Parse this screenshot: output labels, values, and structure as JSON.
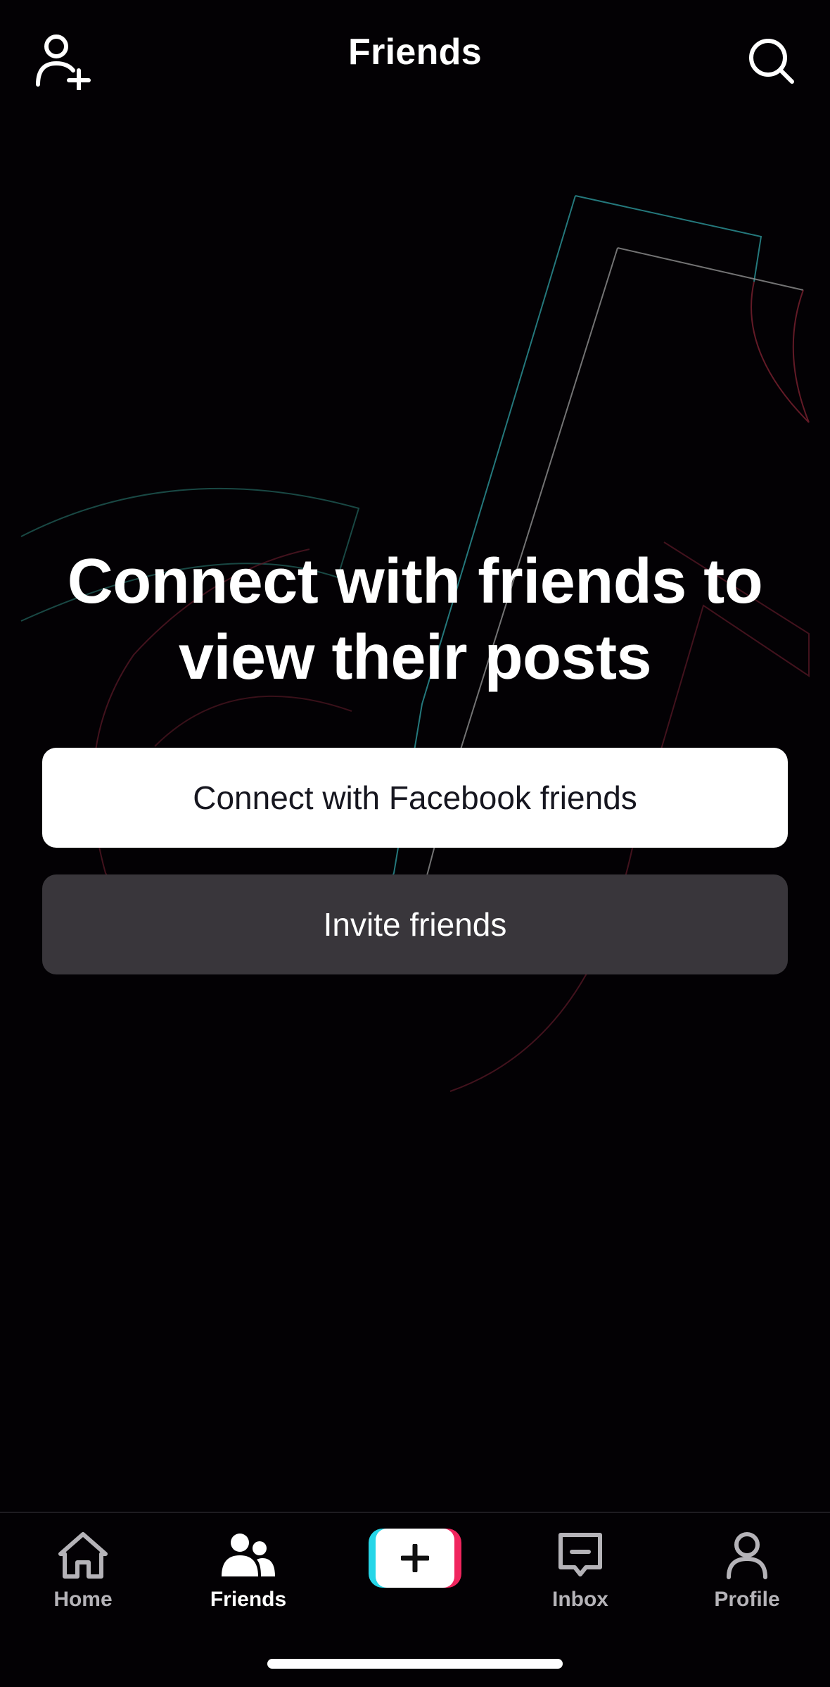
{
  "header": {
    "title": "Friends",
    "left_icon": "add-friend-icon",
    "right_icon": "search-icon"
  },
  "main": {
    "headline_line1": "Connect with friends to",
    "headline_line2": "view their posts",
    "facebook_button_label": "Connect with Facebook friends",
    "invite_button_label": "Invite friends"
  },
  "bottom_nav": {
    "items": [
      {
        "label": "Home",
        "icon": "home-icon",
        "active": false
      },
      {
        "label": "Friends",
        "icon": "friends-icon",
        "active": true
      },
      {
        "label": "",
        "icon": "create-icon",
        "active": false
      },
      {
        "label": "Inbox",
        "icon": "inbox-icon",
        "active": false
      },
      {
        "label": "Profile",
        "icon": "profile-icon",
        "active": false
      }
    ]
  },
  "colors": {
    "background": "#030104",
    "accent_cyan": "#26d6e8",
    "accent_red": "#f0255e",
    "secondary_button": "#39363b"
  }
}
